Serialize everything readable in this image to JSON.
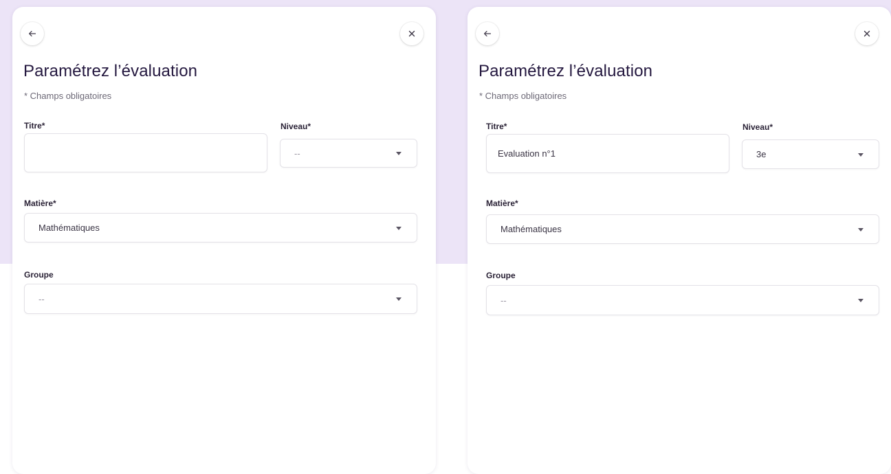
{
  "dialogs": [
    {
      "title": "Paramétrez l’évaluation",
      "required_note": "* Champs obligatoires",
      "titre": {
        "label": "Titre*",
        "value": ""
      },
      "niveau": {
        "label": "Niveau*",
        "value": "--"
      },
      "matiere": {
        "label": "Matière*",
        "value": "Mathématiques"
      },
      "groupe": {
        "label": "Groupe",
        "value": "--"
      }
    },
    {
      "title": "Paramétrez l’évaluation",
      "required_note": "* Champs obligatoires",
      "titre": {
        "label": "Titre*",
        "value": "Evaluation n°1"
      },
      "niveau": {
        "label": "Niveau*",
        "value": "3e"
      },
      "matiere": {
        "label": "Matière*",
        "value": "Mathématiques"
      },
      "groupe": {
        "label": "Groupe",
        "value": "--"
      }
    }
  ],
  "icons": {
    "back": "arrow-left-icon",
    "close": "close-icon",
    "dropdown": "caret-down-icon"
  },
  "colors": {
    "background_band": "#ece4f7",
    "title": "#24183f",
    "card": "#ffffff"
  }
}
